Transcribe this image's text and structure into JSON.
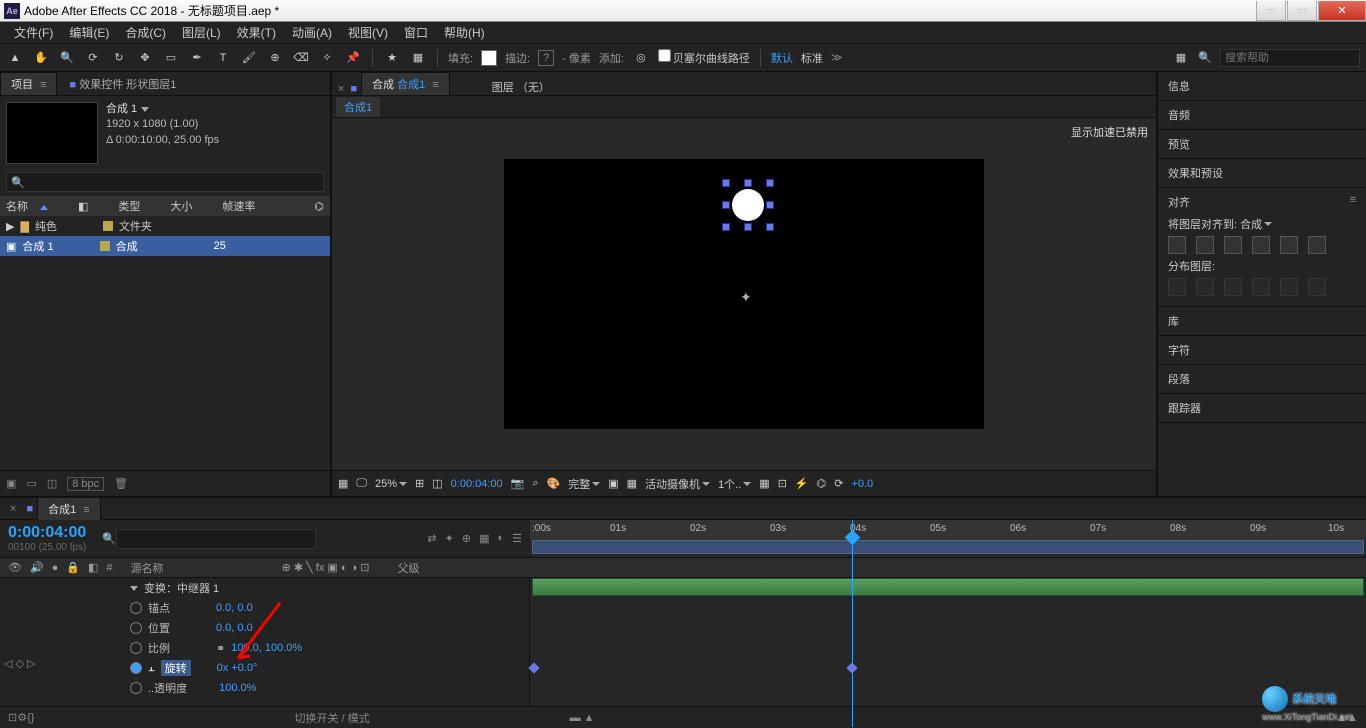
{
  "title": "Adobe After Effects CC 2018 - 无标题项目.aep *",
  "menu": [
    "文件(F)",
    "编辑(E)",
    "合成(C)",
    "图层(L)",
    "效果(T)",
    "动画(A)",
    "视图(V)",
    "窗口",
    "帮助(H)"
  ],
  "toolbar": {
    "fill": "填充:",
    "stroke": "描边:",
    "stroke_q": "?",
    "px": "- 像素",
    "add": "添加:",
    "bezier": "贝塞尔曲线路径",
    "mode_default": "默认",
    "mode_standard": "标准",
    "search_ph": "搜索帮助"
  },
  "project": {
    "tab_project": "项目",
    "tab_fx": "效果控件 形状图层1",
    "comp_name": "合成 1",
    "meta1": "1920 x 1080 (1.00)",
    "meta2": "Δ 0:00:10:00, 25.00 fps",
    "col_name": "名称",
    "col_type": "类型",
    "col_size": "大小",
    "col_fps": "帧速率",
    "row_solid": "纯色",
    "row_solid_type": "文件夹",
    "row_comp": "合成 1",
    "row_comp_type": "合成",
    "row_comp_fps": "25",
    "bpc": "8 bpc"
  },
  "viewer": {
    "tab_comp_prefix": "合成",
    "tab_comp_name": "合成1",
    "layer_none": "图层 （无）",
    "sub_comp": "合成1",
    "gpu": "显示加速已禁用",
    "zoom": "25%",
    "time": "0:00:04:00",
    "res": "完整",
    "camera": "活动摄像机",
    "views": "1个..",
    "exposure": "+0.0"
  },
  "rightPanels": {
    "info": "信息",
    "audio": "音频",
    "preview": "预览",
    "fxpresets": "效果和预设",
    "align": "对齐",
    "align_to": "将图层对齐到:",
    "align_target": "合成",
    "distribute": "分布图层:",
    "library": "库",
    "character": "字符",
    "paragraph": "段落",
    "tracker": "跟踪器"
  },
  "timeline": {
    "tab": "合成1",
    "time": "0:00:04:00",
    "time_sub": "00100 (25.00 fps)",
    "col_src": "源名称",
    "col_parent": "父级",
    "ruler": [
      ":00s",
      "01s",
      "02s",
      "03s",
      "04s",
      "05s",
      "06s",
      "07s",
      "08s",
      "09s",
      "10s"
    ],
    "repeater": "变换：中继器 1",
    "props": [
      {
        "name": "锚点",
        "val": "0.0, 0.0"
      },
      {
        "name": "位置",
        "val": "0.0, 0.0"
      },
      {
        "name": "比例",
        "val": "100.0, 100.0%",
        "link": true
      },
      {
        "name": "旋转",
        "val": "0x +0.0°",
        "sel": true
      },
      {
        "name": "..透明度",
        "val": "100.0%"
      }
    ],
    "toggle": "切换开关 / 模式"
  },
  "watermark": {
    "big": "系统天地",
    "small": "www.XiTongTianDi.net"
  }
}
